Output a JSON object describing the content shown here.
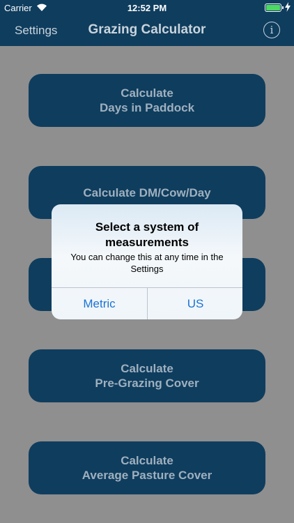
{
  "status_bar": {
    "carrier": "Carrier",
    "time": "12:52 PM"
  },
  "nav": {
    "left_button": "Settings",
    "title": "Grazing Calculator",
    "right_icon": "info-icon",
    "right_icon_glyph": "i"
  },
  "buttons": [
    {
      "line1": "Calculate",
      "line2": "Days in Paddock"
    },
    {
      "line1": "Calculate DM/Cow/Day",
      "line2": ""
    },
    {
      "line1": "",
      "line2": ""
    },
    {
      "line1": "Calculate",
      "line2": "Pre-Grazing Cover"
    },
    {
      "line1": "Calculate",
      "line2": "Average Pasture Cover"
    }
  ],
  "alert": {
    "title": "Select a system of measurements",
    "message": "You can change this at any time in the Settings",
    "options": [
      "Metric",
      "US"
    ]
  },
  "colors": {
    "nav_background": "#0f3d5e",
    "button_background": "#0f3d5e",
    "button_text": "#9fb0be",
    "dimmed_background": "#8f8f8f",
    "alert_action": "#1a73d6",
    "battery": "#4cd964"
  }
}
